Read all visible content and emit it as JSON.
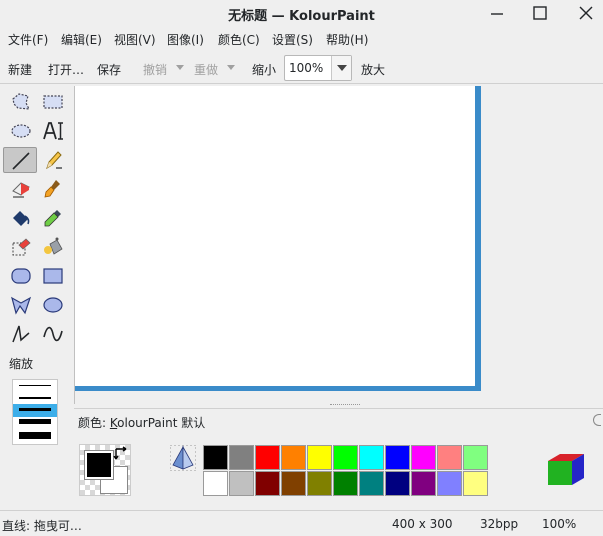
{
  "window": {
    "title": "无标题 — KolourPaint"
  },
  "menubar": {
    "items": [
      {
        "label": "文件(F)"
      },
      {
        "label": "编辑(E)"
      },
      {
        "label": "视图(V)"
      },
      {
        "label": "图像(I)"
      },
      {
        "label": "颜色(C)"
      },
      {
        "label": "设置(S)"
      },
      {
        "label": "帮助(H)"
      }
    ]
  },
  "toolbar": {
    "new_label": "新建",
    "open_label": "打开…",
    "save_label": "保存",
    "undo_label": "撤销",
    "redo_label": "重做",
    "zoom_out_label": "缩小",
    "zoom_value": "100%",
    "zoom_in_label": "放大"
  },
  "toolbox": {
    "tools": [
      {
        "name": "free-form-selection",
        "icon": "lasso-icon"
      },
      {
        "name": "rectangular-selection",
        "icon": "rect-select-icon"
      },
      {
        "name": "elliptical-selection",
        "icon": "ellipse-select-icon"
      },
      {
        "name": "text",
        "icon": "text-icon"
      },
      {
        "name": "line",
        "icon": "line-icon",
        "selected": true
      },
      {
        "name": "pen",
        "icon": "pencil-icon"
      },
      {
        "name": "eraser",
        "icon": "eraser-icon"
      },
      {
        "name": "brush",
        "icon": "brush-icon"
      },
      {
        "name": "flood-fill",
        "icon": "bucket-icon"
      },
      {
        "name": "color-picker",
        "icon": "dropper-icon"
      },
      {
        "name": "color-eraser",
        "icon": "color-eraser-icon"
      },
      {
        "name": "spraycan",
        "icon": "spraycan-icon"
      },
      {
        "name": "rounded-rectangle",
        "icon": "rounded-rect-icon"
      },
      {
        "name": "rectangle",
        "icon": "rectangle-icon"
      },
      {
        "name": "polygon",
        "icon": "polygon-icon"
      },
      {
        "name": "ellipse",
        "icon": "ellipse-icon"
      },
      {
        "name": "connected-lines",
        "icon": "polyline-icon"
      },
      {
        "name": "curve",
        "icon": "curve-icon"
      }
    ],
    "zoom_label": "缩放"
  },
  "color_panel": {
    "label_prefix": "颜色: ",
    "label_accel": "K",
    "label_rest": "olourPaint 默认",
    "foreground": "#000000",
    "background": "#ffffff",
    "palette_top": [
      "#000000",
      "#808080",
      "#ff0000",
      "#ff8000",
      "#ffff00",
      "#00ff00",
      "#00ffff",
      "#0000ff",
      "#ff00ff",
      "#ff8080",
      "#80ff80"
    ],
    "palette_bottom": [
      "#ffffff",
      "#c0c0c0",
      "#800000",
      "#804000",
      "#808000",
      "#008000",
      "#008080",
      "#000080",
      "#800080",
      "#8080ff",
      "#ffff80"
    ]
  },
  "statusbar": {
    "message": "直线: 拖曳可…",
    "size": "400 x 300",
    "depth": "32bpp",
    "zoom": "100%"
  },
  "colors": {
    "accent": "#3daee9",
    "canvas_border": "#3a8bc9"
  }
}
